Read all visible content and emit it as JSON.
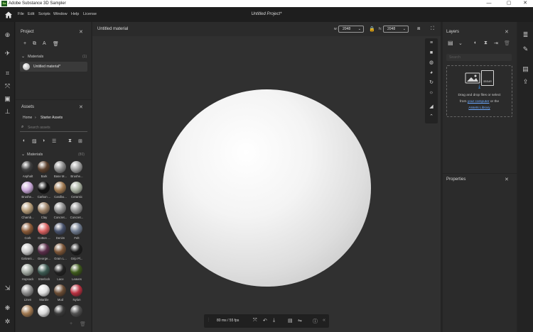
{
  "titlebar": {
    "app_title": "Adobe Substance 3D Sampler",
    "logo_text": "Sa",
    "minimize": "—",
    "maximize": "▢",
    "close": "✕"
  },
  "menu": {
    "items": [
      "File",
      "Edit",
      "Scripts",
      "Window",
      "Help",
      "License"
    ],
    "project_title": "Untitled Project*"
  },
  "project": {
    "title": "Project",
    "section": "Materials",
    "section_count": "(1)",
    "material_name": "Untitled material*"
  },
  "assets": {
    "title": "Assets",
    "breadcrumb_home": "Home",
    "breadcrumb_current": "Starter Assets",
    "search_placeholder": "Search assets",
    "section": "Materials",
    "section_count": "(80)",
    "materials": [
      {
        "label": "Asphalt",
        "color": "#3f3f3f"
      },
      {
        "label": "Bark",
        "color": "#5a3f2c"
      },
      {
        "label": "Base M...",
        "color": "#8a8a8a"
      },
      {
        "label": "Brushe...",
        "color": "#9e9e9e"
      },
      {
        "label": "Brushe...",
        "color": "#c9a8d8"
      },
      {
        "label": "Carbon ...",
        "color": "#111111"
      },
      {
        "label": "Cardbo...",
        "color": "#a07a52"
      },
      {
        "label": "Ceramic",
        "color": "#a8b0a0"
      },
      {
        "label": "Chamb...",
        "color": "#b59c78"
      },
      {
        "label": "Clay",
        "color": "#9c8268"
      },
      {
        "label": "Concret...",
        "color": "#8c8c8c"
      },
      {
        "label": "Concret...",
        "color": "#909090"
      },
      {
        "label": "Cork",
        "color": "#8a5a38"
      },
      {
        "label": "Cotton ...",
        "color": "#d86060"
      },
      {
        "label": "Denim",
        "color": "#46506a"
      },
      {
        "label": "Felt",
        "color": "#6e7a8e"
      },
      {
        "label": "Galvani...",
        "color": "#c8c8c8"
      },
      {
        "label": "George...",
        "color": "#5a2e4a"
      },
      {
        "label": "Grain L...",
        "color": "#7a5436"
      },
      {
        "label": "Grip Pl...",
        "color": "#1c1c1c"
      },
      {
        "label": "Hopsack",
        "color": "#a0a8a0"
      },
      {
        "label": "Interlock",
        "color": "#3c5a52"
      },
      {
        "label": "Lace",
        "color": "#222222"
      },
      {
        "label": "Leaves",
        "color": "#3e5a1c"
      },
      {
        "label": "Linen",
        "color": "#8c8c8c"
      },
      {
        "label": "Marble",
        "color": "#e0e0e0"
      },
      {
        "label": "Mud",
        "color": "#6a4c34"
      },
      {
        "label": "Nylon",
        "color": "#b83040"
      },
      {
        "label": "",
        "color": "#a07850"
      },
      {
        "label": "",
        "color": "#d8d8d8"
      },
      {
        "label": "",
        "color": "#3a3a3a"
      },
      {
        "label": "",
        "color": "#505050"
      }
    ]
  },
  "viewport": {
    "material_name": "Untitled material",
    "w_label": "w:",
    "w_value": "2048",
    "h_label": "h:",
    "h_value": "2048",
    "fps": "80 ms / 55 fps"
  },
  "layers": {
    "title": "Layers",
    "search_placeholder": "Search",
    "drop_line1": "Drag and drop files or select",
    "drop_from": "from",
    "drop_link1": "your computer",
    "drop_or_the": "or the",
    "drop_link2": "Assets Library",
    "sbsar_label": "SBSAR"
  },
  "properties": {
    "title": "Properties"
  }
}
